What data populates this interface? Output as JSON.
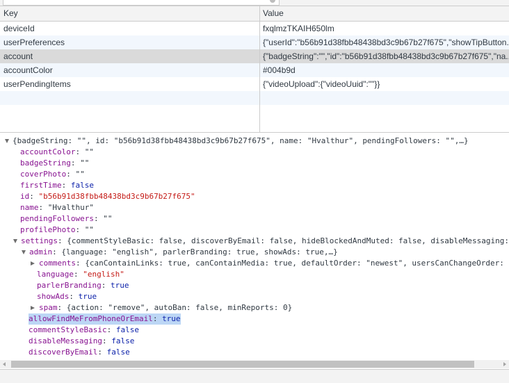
{
  "table": {
    "headers": {
      "key": "Key",
      "value": "Value"
    },
    "rows": [
      {
        "key": "deviceId",
        "value": "fxqlmzTKAIH650lm"
      },
      {
        "key": "userPreferences",
        "value": "{\"userId\":\"b56b91d38fbb48438bd3c9b67b27f675\",\"showTipButton..."
      },
      {
        "key": "account",
        "value": "{\"badgeString\":\"\",\"id\":\"b56b91d38fbb48438bd3c9b67b27f675\",\"na..."
      },
      {
        "key": "accountColor",
        "value": "#004b9d"
      },
      {
        "key": "userPendingItems",
        "value": "{\"videoUpload\":{\"videoUuid\":\"\"}}"
      }
    ]
  },
  "tree": {
    "summary": "{badgeString: \"\", id: \"b56b91d38fbb48438bd3c9b67b27f675\", name: \"Hvalthur\", pendingFollowers: \"\",…}",
    "accountColor": {
      "key": "accountColor",
      "value": "\"\""
    },
    "badgeString": {
      "key": "badgeString",
      "value": "\"\""
    },
    "coverPhoto": {
      "key": "coverPhoto",
      "value": "\"\""
    },
    "firstTime": {
      "key": "firstTime",
      "value": "false"
    },
    "id": {
      "key": "id",
      "value": "\"b56b91d38fbb48438bd3c9b67b27f675\""
    },
    "name": {
      "key": "name",
      "value": "\"Hvalthur\""
    },
    "pendingFollowers": {
      "key": "pendingFollowers",
      "value": "\"\""
    },
    "profilePhoto": {
      "key": "profilePhoto",
      "value": "\"\""
    },
    "settings": {
      "key": "settings",
      "value": "{commentStyleBasic: false, discoverByEmail: false, hideBlockedAndMuted: false, disableMessaging:"
    },
    "admin": {
      "key": "admin",
      "value": "{language: \"english\", parlerBranding: true, showAds: true,…}"
    },
    "comments": {
      "key": "comments",
      "value": "{canContainLinks: true, canContainMedia: true, defaultOrder: \"newest\", usersCanChangeOrder: t"
    },
    "language": {
      "key": "language",
      "value": "\"english\""
    },
    "parlerBranding": {
      "key": "parlerBranding",
      "value": "true"
    },
    "showAds": {
      "key": "showAds",
      "value": "true"
    },
    "spam": {
      "key": "spam",
      "value": "{action: \"remove\", autoBan: false, minReports: 0}"
    },
    "allowFind": {
      "key": "allowFindMeFromPhoneOrEmail",
      "value": "true"
    },
    "commentStyleBasic": {
      "key": "commentStyleBasic",
      "value": "false"
    },
    "disableMessaging": {
      "key": "disableMessaging",
      "value": "false"
    },
    "discoverByEmail": {
      "key": "discoverByEmail",
      "value": "false"
    }
  },
  "colors": {
    "key": "#881391",
    "string": "#c41a16",
    "keyword": "#0d22aa",
    "selected_row": "#dadada",
    "highlight": "#bcd6f5"
  }
}
